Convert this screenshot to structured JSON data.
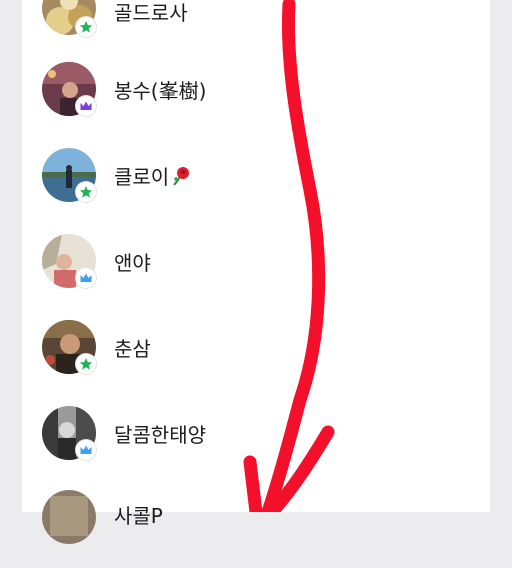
{
  "members": [
    {
      "name": "골드로사",
      "badge": "star-green"
    },
    {
      "name": "봉수(峯樹)",
      "badge": "crown-purple"
    },
    {
      "name": "클로이",
      "badge": "star-green",
      "emoji": "rose-icon"
    },
    {
      "name": "앤야",
      "badge": "crown-blue"
    },
    {
      "name": "춘삼",
      "badge": "star-green"
    },
    {
      "name": "달콤한태양",
      "badge": "crown-blue"
    },
    {
      "name": "사콜P",
      "badge": "none"
    }
  ],
  "colors": {
    "background": "#ececef",
    "panel": "#ffffff",
    "arrow": "#f4102b",
    "star_badge": "#20b356",
    "crown_purple": "#7d3fd9",
    "crown_blue": "#3aa0f0",
    "text": "#1c1c1c"
  },
  "annotation": "red-drawn-down-arrow"
}
